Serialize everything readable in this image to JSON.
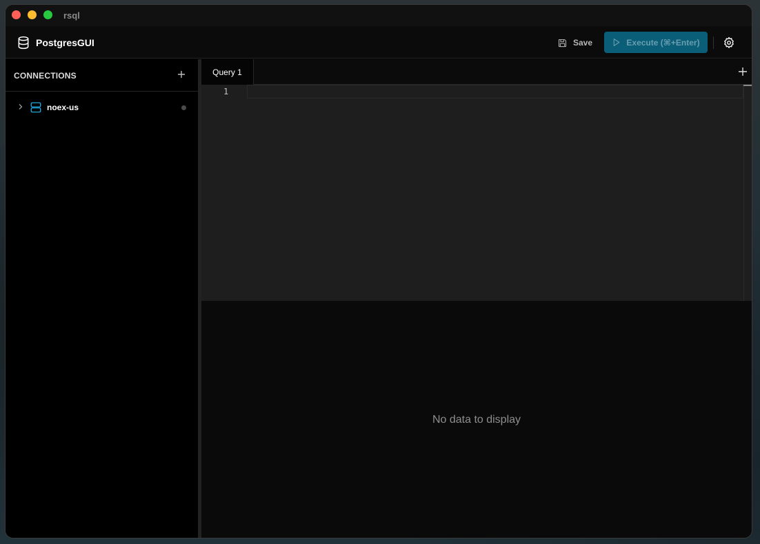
{
  "window": {
    "title": "rsql"
  },
  "header": {
    "app_name": "PostgresGUI",
    "logo_icon": "database-icon",
    "save_label": "Save",
    "execute_label": "Execute (⌘+Enter)",
    "settings_icon": "gear-icon",
    "accent_color": "#0a5e78"
  },
  "sidebar": {
    "title": "CONNECTIONS",
    "add_icon": "plus-icon",
    "connections": [
      {
        "label": "noex-us",
        "icon": "server-icon",
        "expanded": false,
        "status": "disconnected"
      }
    ]
  },
  "tabs": [
    {
      "label": "Query 1",
      "active": true
    }
  ],
  "editor": {
    "line_numbers": [
      "1"
    ],
    "content": ""
  },
  "results": {
    "empty_message": "No data to display"
  }
}
